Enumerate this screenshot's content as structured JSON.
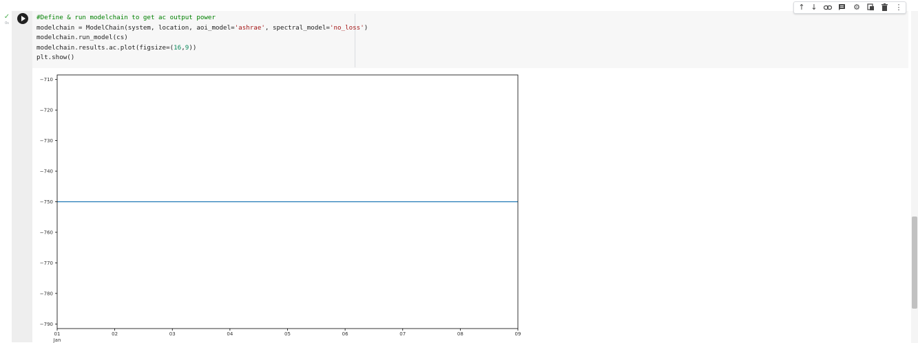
{
  "cell": {
    "status_icon": "check-icon",
    "exec_count": "0s",
    "run_icon": "play-icon",
    "code_lines": [
      [
        {
          "t": "#Define & run modelchain to get ac output power",
          "c": "comment"
        }
      ],
      [
        {
          "t": "modelchain = ModelChain(system, location, aoi_model=",
          "c": "plain"
        },
        {
          "t": "'ashrae'",
          "c": "string"
        },
        {
          "t": ", spectral_model=",
          "c": "plain"
        },
        {
          "t": "'no_loss'",
          "c": "string"
        },
        {
          "t": ")",
          "c": "plain"
        }
      ],
      [
        {
          "t": "modelchain.run_model(cs)",
          "c": "plain"
        }
      ],
      [
        {
          "t": "modelchain.results.ac.plot(figsize=(",
          "c": "plain"
        },
        {
          "t": "16",
          "c": "number"
        },
        {
          "t": ",",
          "c": "plain"
        },
        {
          "t": "9",
          "c": "number"
        },
        {
          "t": "))",
          "c": "plain"
        }
      ],
      [
        {
          "t": "plt.show()",
          "c": "plain"
        }
      ]
    ]
  },
  "toolbar": {
    "buttons": [
      "arrow-up-icon",
      "arrow-down-icon",
      "link-icon",
      "comment-icon",
      "gear-icon",
      "mirror-cell-icon",
      "delete-icon",
      "more-vertical-icon"
    ]
  },
  "colors": {
    "line": "#1f77b4",
    "comment": "#008000",
    "string": "#a31515",
    "number": "#09885a"
  },
  "chart_data": {
    "type": "line",
    "x": [
      "01",
      "02",
      "03",
      "04",
      "05",
      "06",
      "07",
      "08",
      "09"
    ],
    "x_sublabel": "Jan",
    "series": [
      {
        "values": [
          -750,
          -750,
          -750,
          -750,
          -750,
          -750,
          -750,
          -750,
          -750
        ]
      }
    ],
    "yticks": [
      -710,
      -720,
      -730,
      -740,
      -750,
      -760,
      -770,
      -780,
      -790
    ],
    "ylim": [
      -791.5,
      -708.5
    ],
    "title": "",
    "xlabel": "",
    "ylabel": "",
    "grid": false
  }
}
